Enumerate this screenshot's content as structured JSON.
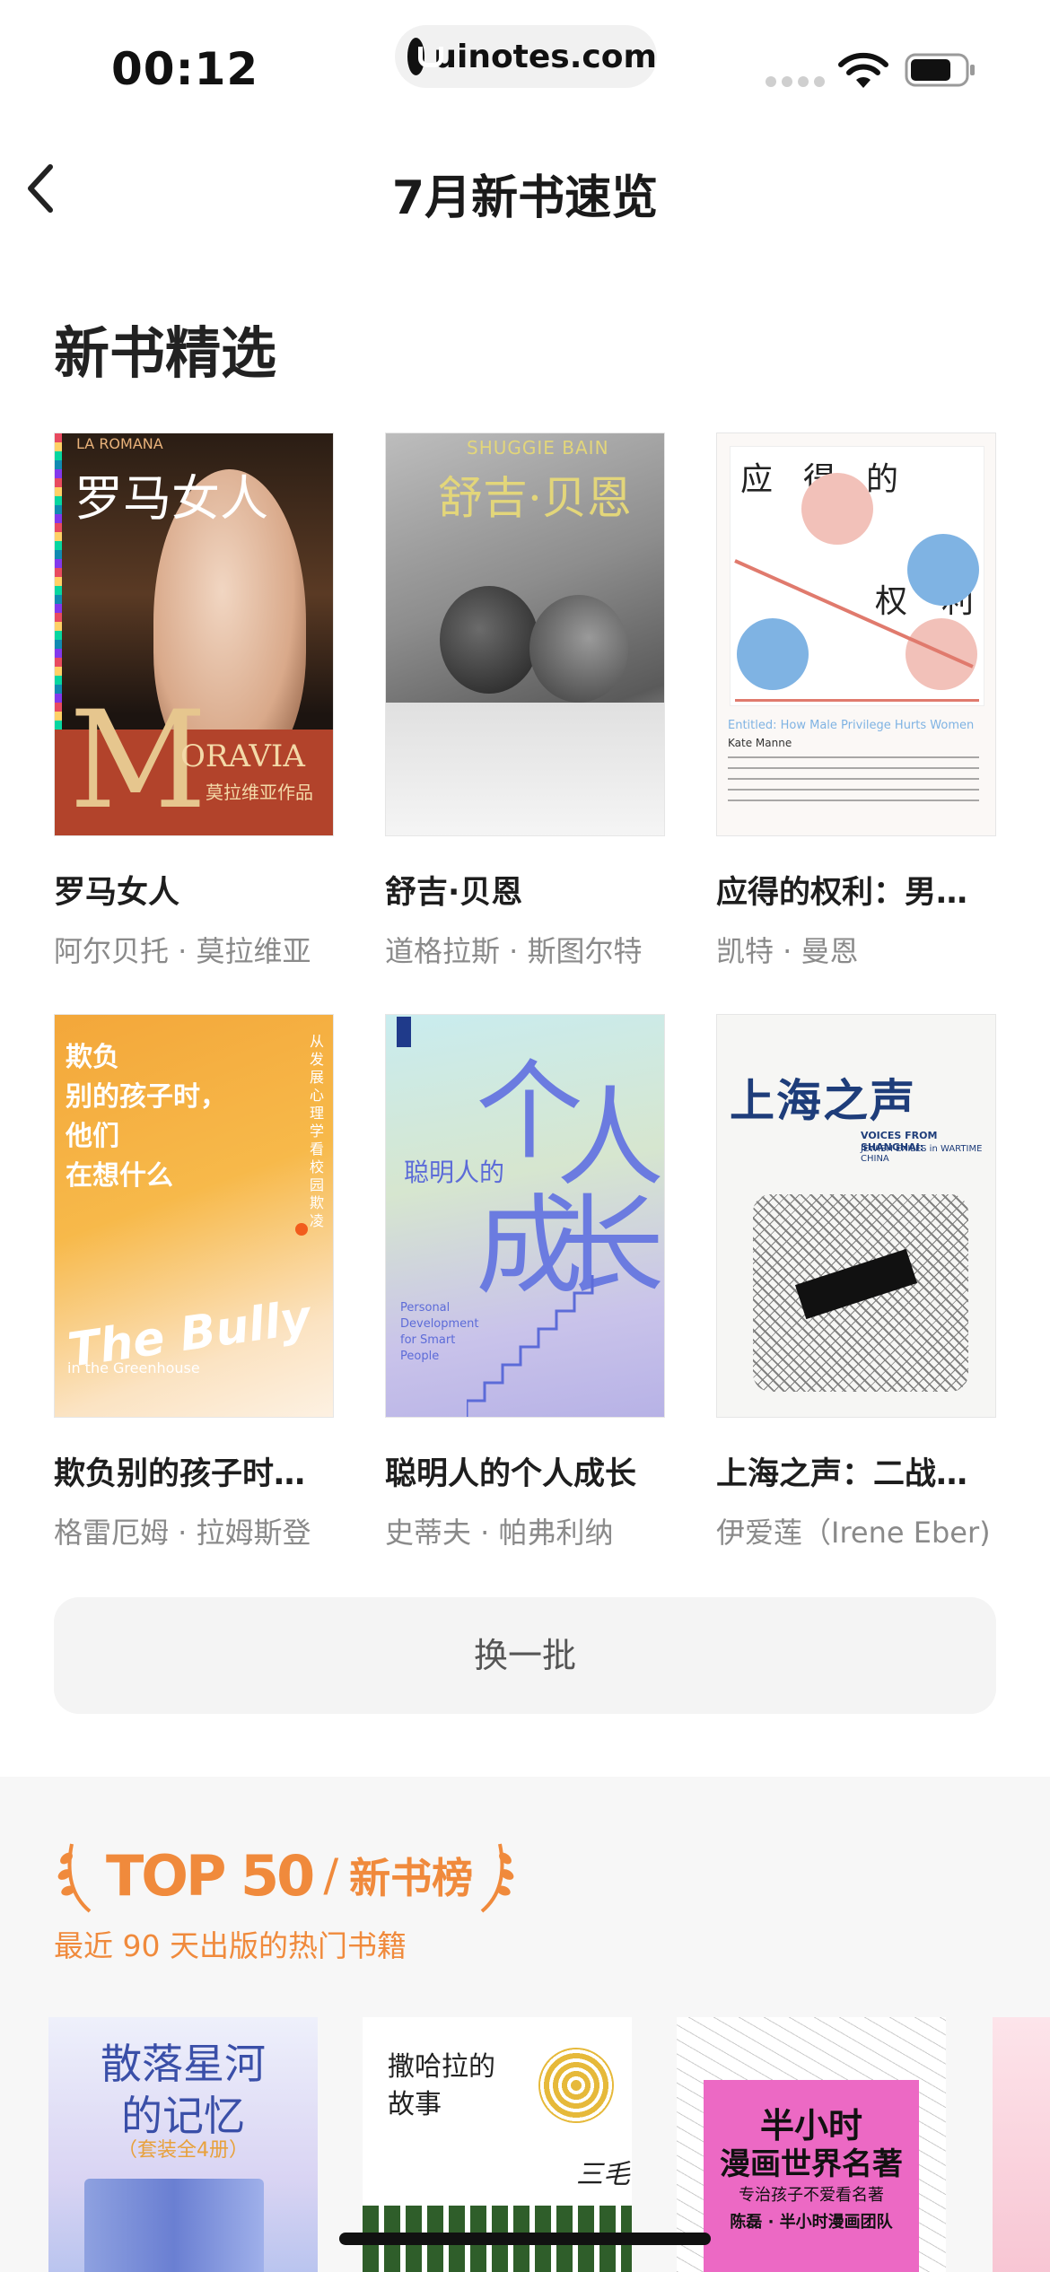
{
  "status_bar": {
    "time": "00:12",
    "url": "uinotes.com"
  },
  "nav": {
    "title": "7月新书速览"
  },
  "section": {
    "title": "新书精选"
  },
  "books": [
    {
      "title": "罗马女人",
      "author": "阿尔贝托 · 莫拉维亚",
      "cover_title": "罗马女人",
      "cover_top": "LA ROMANA",
      "cover_bottom": "ORAVIA",
      "cover_sub": "莫拉维亚作品",
      "cover_letter": "M"
    },
    {
      "title": "舒吉·贝恩",
      "author": "道格拉斯 · 斯图尔特",
      "cover_top": "SHUGGIE BAIN",
      "cover_title": "舒吉·贝恩"
    },
    {
      "title": "应得的权利：男…",
      "author": "凯特 · 曼恩",
      "cover_title_1": "应",
      "cover_title_2": "得",
      "cover_title_3": "的",
      "cover_title_4": "权",
      "cover_title_5": "利",
      "cover_en": "Entitled: How Male Privilege Hurts Women",
      "cover_author_en": "Kate Manne"
    },
    {
      "title": "欺负别的孩子时…",
      "author": "格雷厄姆 · 拉姆斯登",
      "cover_lines": [
        "欺负",
        "别的孩子时，",
        "他们",
        "在想什么"
      ],
      "cover_side": "从发展心理学看校园欺凌",
      "cover_en": "The Bully",
      "cover_en_2": "in the Greenhouse"
    },
    {
      "title": "聪明人的个人成长",
      "author": "史蒂夫 · 帕弗利纳",
      "cover_small": "聪明人的",
      "cover_big_1": "个",
      "cover_big_2": "人",
      "cover_big_3": "成",
      "cover_big_4": "长",
      "cover_en": "Personal Development for Smart People"
    },
    {
      "title": "上海之声：二战…",
      "author": "伊爱莲（Irene Eber)",
      "cover_title": "上海之声",
      "cover_en": "VOICES FROM SHANGHAI:",
      "cover_en_sub": "JEWISH EXILES in WARTIME CHINA"
    }
  ],
  "swap_button": {
    "label": "换一批"
  },
  "top50": {
    "brand": "TOP 50",
    "slash": "/",
    "label": "新书榜",
    "subtitle": "最近 90 天出版的热门书籍"
  },
  "ranked_books": [
    {
      "cover_title_1": "散落星河",
      "cover_title_2": "的记忆",
      "cover_sub": "（套装全4册）"
    },
    {
      "cover_title_1": "撒哈拉的",
      "cover_title_2": "故事",
      "cover_sign": "三毛"
    },
    {
      "cover_title_1": "半小时",
      "cover_title_2": "漫画世界名著",
      "cover_sub": "专治孩子不爱看名著",
      "cover_author": "陈磊 · 半小时漫画团队"
    }
  ],
  "colors": {
    "accent_orange": "#f08a3c",
    "text_primary": "#1e1e1e",
    "text_secondary": "#8a8a8a",
    "button_bg": "#f4f4f4"
  }
}
